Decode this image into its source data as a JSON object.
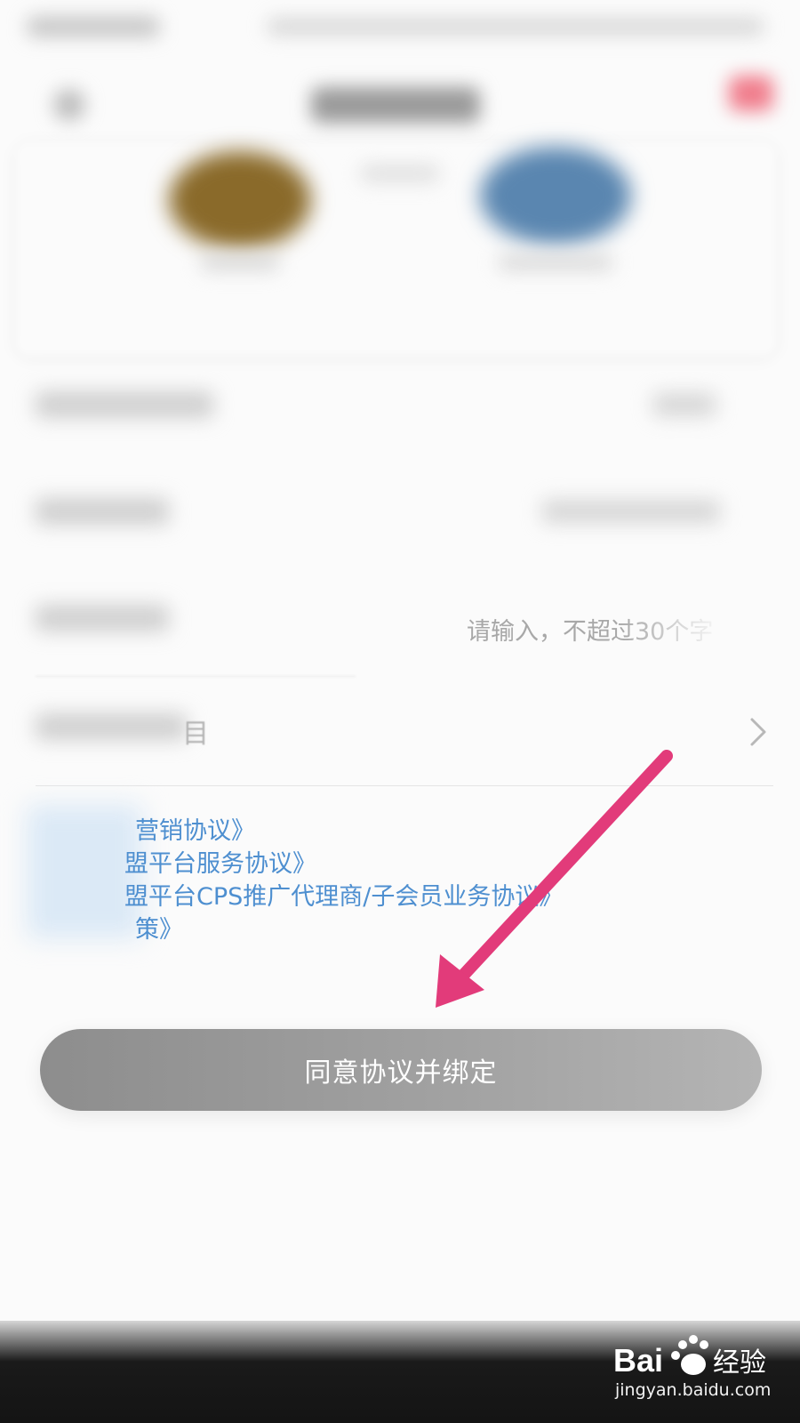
{
  "form": {
    "note_placeholder": "请输入，不超过30个字",
    "category_suffix": "目"
  },
  "agreements": {
    "lines": [
      "营销协议》",
      "盟平台服务协议》",
      "盟平台CPS推广代理商/子会员业务协议》",
      "策》"
    ]
  },
  "action": {
    "submit_label": "同意协议并绑定"
  },
  "watermark": {
    "brand": "Bai经验",
    "url": "jingyan.baidu.com"
  },
  "colors": {
    "link_blue": "#4e8fd0",
    "button_gray": "#a3a3a3",
    "arrow_pink": "#e23b7a"
  },
  "icons": {
    "back": "back-arrow-icon",
    "chevron": "chevron-right-icon",
    "annotation": "pink-arrow-annotation"
  }
}
